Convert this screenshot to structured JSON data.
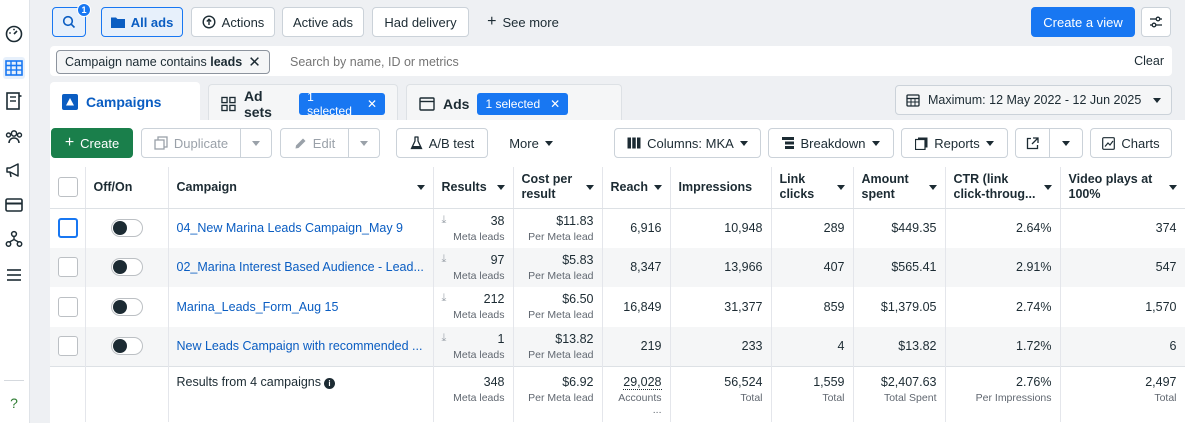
{
  "topbar": {
    "search_badge": "1",
    "all_ads": "All ads",
    "actions": "Actions",
    "active_ads": "Active ads",
    "had_delivery": "Had delivery",
    "see_more": "See more",
    "create_view": "Create a view"
  },
  "filter": {
    "chip_prefix": "Campaign name contains ",
    "chip_value": "leads",
    "placeholder": "Search by name, ID or metrics",
    "clear": "Clear"
  },
  "tabs": {
    "campaigns": "Campaigns",
    "adsets": "Ad sets",
    "adsets_selected": "1 selected",
    "ads": "Ads",
    "ads_selected": "1 selected",
    "date_range": "Maximum: 12 May 2022 - 12 Jun 2025"
  },
  "toolbar": {
    "create": "Create",
    "duplicate": "Duplicate",
    "edit": "Edit",
    "ab_test": "A/B test",
    "more": "More",
    "columns": "Columns: MKA",
    "breakdown": "Breakdown",
    "reports": "Reports",
    "charts": "Charts"
  },
  "columns": {
    "offon": "Off/On",
    "campaign": "Campaign",
    "results": "Results",
    "cost_per_result": "Cost per result",
    "reach": "Reach",
    "impressions": "Impressions",
    "link_clicks": "Link clicks",
    "amount_spent": "Amount spent",
    "ctr": "CTR (link click-throug...",
    "video_plays": "Video plays at 100%"
  },
  "rows": [
    {
      "campaign": "04_New Marina Leads Campaign_May 9",
      "results": "38",
      "results_sub": "Meta leads",
      "cost": "$11.83",
      "cost_sub": "Per Meta lead",
      "reach": "6,916",
      "impressions": "10,948",
      "clicks": "289",
      "spent": "$449.35",
      "ctr": "2.64%",
      "video": "374"
    },
    {
      "campaign": "02_Marina Interest Based Audience - Lead...",
      "results": "97",
      "results_sub": "Meta leads",
      "cost": "$5.83",
      "cost_sub": "Per Meta lead",
      "reach": "8,347",
      "impressions": "13,966",
      "clicks": "407",
      "spent": "$565.41",
      "ctr": "2.91%",
      "video": "547"
    },
    {
      "campaign": "Marina_Leads_Form_Aug 15",
      "results": "212",
      "results_sub": "Meta leads",
      "cost": "$6.50",
      "cost_sub": "Per Meta lead",
      "reach": "16,849",
      "impressions": "31,377",
      "clicks": "859",
      "spent": "$1,379.05",
      "ctr": "2.74%",
      "video": "1,570"
    },
    {
      "campaign": "New Leads Campaign with recommended ...",
      "results": "1",
      "results_sub": "Meta leads",
      "cost": "$13.82",
      "cost_sub": "Per Meta lead",
      "reach": "219",
      "impressions": "233",
      "clicks": "4",
      "spent": "$13.82",
      "ctr": "1.72%",
      "video": "6"
    }
  ],
  "summary": {
    "label": "Results from 4 campaigns",
    "results": "348",
    "results_sub": "Meta leads",
    "cost": "$6.92",
    "cost_sub": "Per Meta lead",
    "reach": "29,028",
    "reach_sub": "Accounts ...",
    "impressions": "56,524",
    "impressions_sub": "Total",
    "clicks": "1,559",
    "clicks_sub": "Total",
    "spent": "$2,407.63",
    "spent_sub": "Total Spent",
    "ctr": "2.76%",
    "ctr_sub": "Per Impressions",
    "video": "2,497",
    "video_sub": "Total"
  },
  "colors": {
    "accent": "#1877f2",
    "link": "#0a5dc2"
  }
}
